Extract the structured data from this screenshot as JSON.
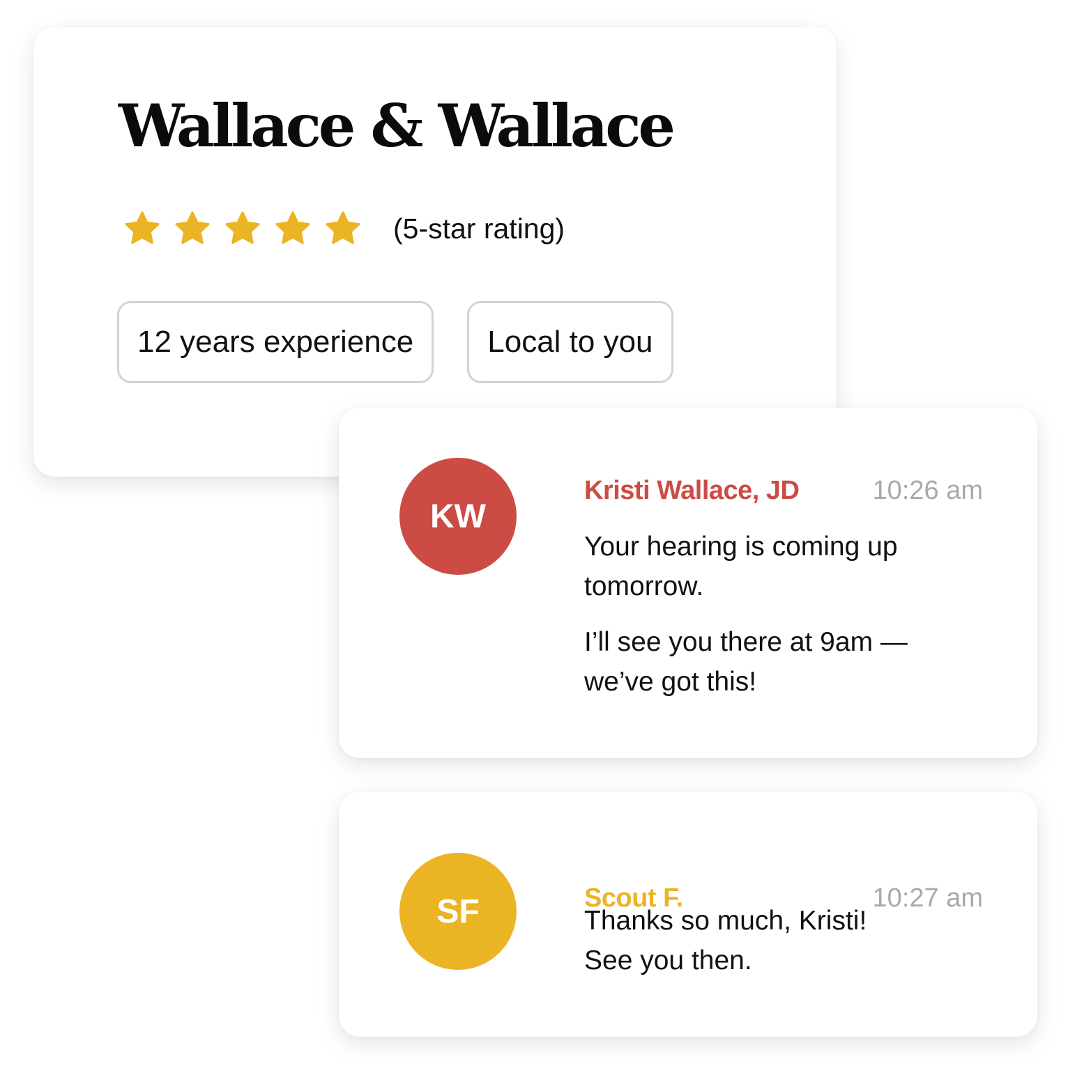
{
  "firm": {
    "name": "Wallace & Wallace",
    "rating": {
      "stars": 5,
      "max_stars": 5,
      "label": "(5-star rating)",
      "star_color": "#ebb424"
    },
    "badges": [
      {
        "label": "12 years experience"
      },
      {
        "label": "Local to you"
      }
    ]
  },
  "messages": [
    {
      "avatar_initials": "KW",
      "avatar_color": "#cc4b45",
      "sender": "Kristi Wallace, JD",
      "time": "10:26 am",
      "paragraphs": [
        "Your hearing is coming up tomorrow.",
        "I’ll see you there at 9am — we’ve got this!"
      ]
    },
    {
      "avatar_initials": "SF",
      "avatar_color": "#ebb424",
      "sender": "Scout F.",
      "time": "10:27 am",
      "paragraphs": [
        "Thanks so much, Kristi!",
        "See you then."
      ]
    }
  ]
}
